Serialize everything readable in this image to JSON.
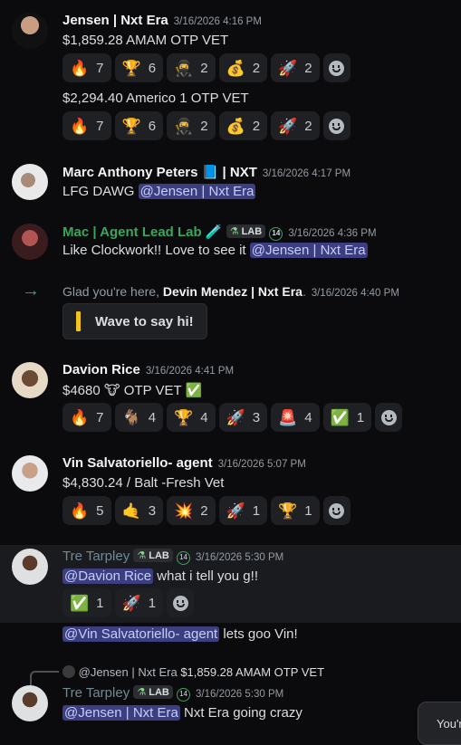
{
  "messages": [
    {
      "author": "Jensen | Nxt Era",
      "time": "3/16/2026 4:16 PM",
      "lines": [
        "$1,859.28 AMAM OTP VET",
        "$2,294.40 Americo 1 OTP VET"
      ],
      "reactions1": [
        {
          "emoji": "🔥",
          "count": "7"
        },
        {
          "emoji": "🏆",
          "count": "6"
        },
        {
          "emoji": "🥷",
          "count": "2"
        },
        {
          "emoji": "💰",
          "count": "2"
        },
        {
          "emoji": "🚀",
          "count": "2"
        }
      ],
      "reactions2": [
        {
          "emoji": "🔥",
          "count": "7"
        },
        {
          "emoji": "🏆",
          "count": "6"
        },
        {
          "emoji": "🥷",
          "count": "2"
        },
        {
          "emoji": "💰",
          "count": "2"
        },
        {
          "emoji": "🚀",
          "count": "2"
        }
      ]
    },
    {
      "author": "Marc Anthony Peters 📘 | NXT",
      "time": "3/16/2026 4:17 PM",
      "text": "LFG DAWG",
      "mention": "@Jensen | Nxt Era"
    },
    {
      "author": "Mac | Agent Lead Lab 🧪",
      "author_color": "#3ba55d",
      "tag": "LAB",
      "badge": "14",
      "time": "3/16/2026 4:36 PM",
      "text": "Like Clockwork!! Love to see it",
      "mention": "@Jensen | Nxt Era"
    },
    {
      "system_prefix": "Glad you're here,",
      "system_user": "Devin Mendez | Nxt Era",
      "system_suffix": ".",
      "time": "3/16/2026 4:40 PM",
      "wave_label": "Wave to say hi!"
    },
    {
      "author": "Davion Rice",
      "time": "3/16/2026 4:41 PM",
      "text": "$4680 🐮 OTP VET ✅",
      "reactions": [
        {
          "emoji": "🔥",
          "count": "7"
        },
        {
          "emoji": "🐐",
          "count": "4"
        },
        {
          "emoji": "🏆",
          "count": "4"
        },
        {
          "emoji": "🚀",
          "count": "3"
        },
        {
          "emoji": "🚨",
          "count": "4"
        },
        {
          "emoji": "✅",
          "count": "1"
        }
      ]
    },
    {
      "author": "Vin Salvatoriello- agent",
      "time": "3/16/2026 5:07 PM",
      "text": "$4,830.24 / Balt -Fresh Vet",
      "reactions": [
        {
          "emoji": "🔥",
          "count": "5"
        },
        {
          "emoji": "🤙",
          "count": "3"
        },
        {
          "emoji": "💥",
          "count": "2"
        },
        {
          "emoji": "🚀",
          "count": "1"
        },
        {
          "emoji": "🏆",
          "count": "1"
        }
      ]
    },
    {
      "author": "Tre Tarpley",
      "author_color": "#6f8a96",
      "tag": "LAB",
      "badge": "14",
      "time": "3/16/2026 5:30 PM",
      "mention": "@Davion Rice",
      "text": "what i tell you g!!",
      "reactions": [
        {
          "emoji": "✅",
          "count": "1"
        },
        {
          "emoji": "🚀",
          "count": "1"
        }
      ],
      "followup_mention": "@Vin Salvatoriello- agent",
      "followup_text": "lets goo Vin!"
    },
    {
      "reply_user": "@Jensen | Nxt Era",
      "reply_text": "$1,859.28 AMAM OTP VET",
      "author": "Tre Tarpley",
      "author_color": "#6f8a96",
      "tag": "LAB",
      "badge": "14",
      "time": "3/16/2026 5:30 PM",
      "mention": "@Jensen | Nxt Era",
      "text": "Nxt Era going crazy"
    }
  ],
  "toast": {
    "text": "You'r"
  },
  "colors": {
    "mention_bg": "#3b3f82",
    "green": "#3ba55d",
    "arrow": "#3ba55d"
  },
  "icons": {
    "join_arrow": "arrow-right-icon",
    "wave": "wave-icon"
  }
}
